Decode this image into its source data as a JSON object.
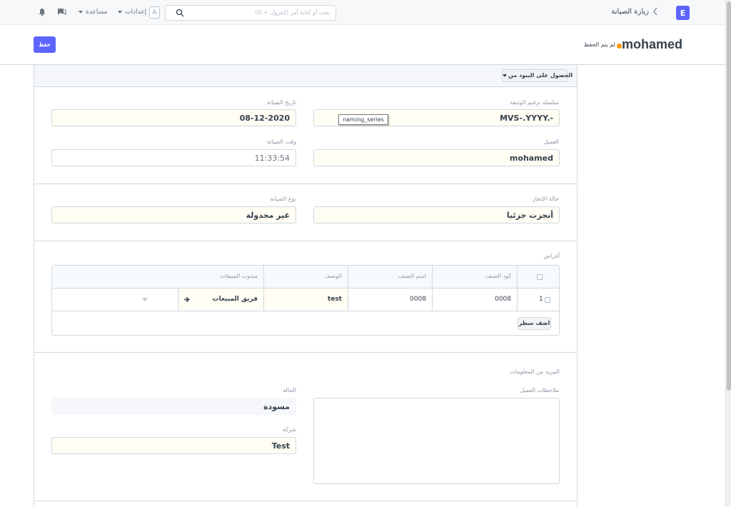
{
  "navbar": {
    "brand_letter": "E",
    "breadcrumb": "زيارة الصيانة",
    "search_placeholder": "بحث أو كتابة أمر (كنترول + G)",
    "user_initial": "A",
    "settings_label": "إعدادات",
    "help_label": "مساعدة",
    "icons": [
      "bell-icon",
      "chat-icon",
      "search-icon",
      "chevron-left-icon"
    ]
  },
  "header": {
    "title": "mohamed",
    "status": "لم يتم الحفظ",
    "status_color": "#ff9a00",
    "save_label": "حفظ",
    "accent": "#5e64ff"
  },
  "toolbar": {
    "get_items_label": "الحصول على البنود من"
  },
  "fields": {
    "naming_series_label": "سلسلة ترقيم الوثيقة",
    "naming_series_value": "MVS-.YYYY.-",
    "naming_series_tooltip": "naming_series",
    "maintenance_date_label": "تاريخ الصيانة",
    "maintenance_date_value": "08-12-2020",
    "customer_label": "العميل",
    "customer_value": "mohamed",
    "maintenance_time_label": "وقت الصيانة",
    "maintenance_time_value": "11:33:54",
    "completion_status_label": "حالة الإنجاز",
    "completion_status_value": "أنجزت جزئيا",
    "maintenance_type_label": "نوع الصيانة",
    "maintenance_type_value": "غير مجدولة"
  },
  "purposes": {
    "label": "أغراض",
    "columns": [
      "كود الصنف",
      "اسم الصنف",
      "الوصف",
      "مندوب المبيعات"
    ],
    "rows": [
      {
        "idx": "1",
        "item_code": "0008",
        "item_name": "0008",
        "description": "test",
        "sales_person": "فريق المبيعات"
      }
    ],
    "add_row_label": "اضف سطر"
  },
  "more_info": {
    "section_title": "المزيد من المعلومات",
    "customer_feedback_label": "ملاحظات العميل",
    "status_label": "الحالة",
    "status_value": "مسودة",
    "company_label": "شركة",
    "company_value": "Test"
  }
}
